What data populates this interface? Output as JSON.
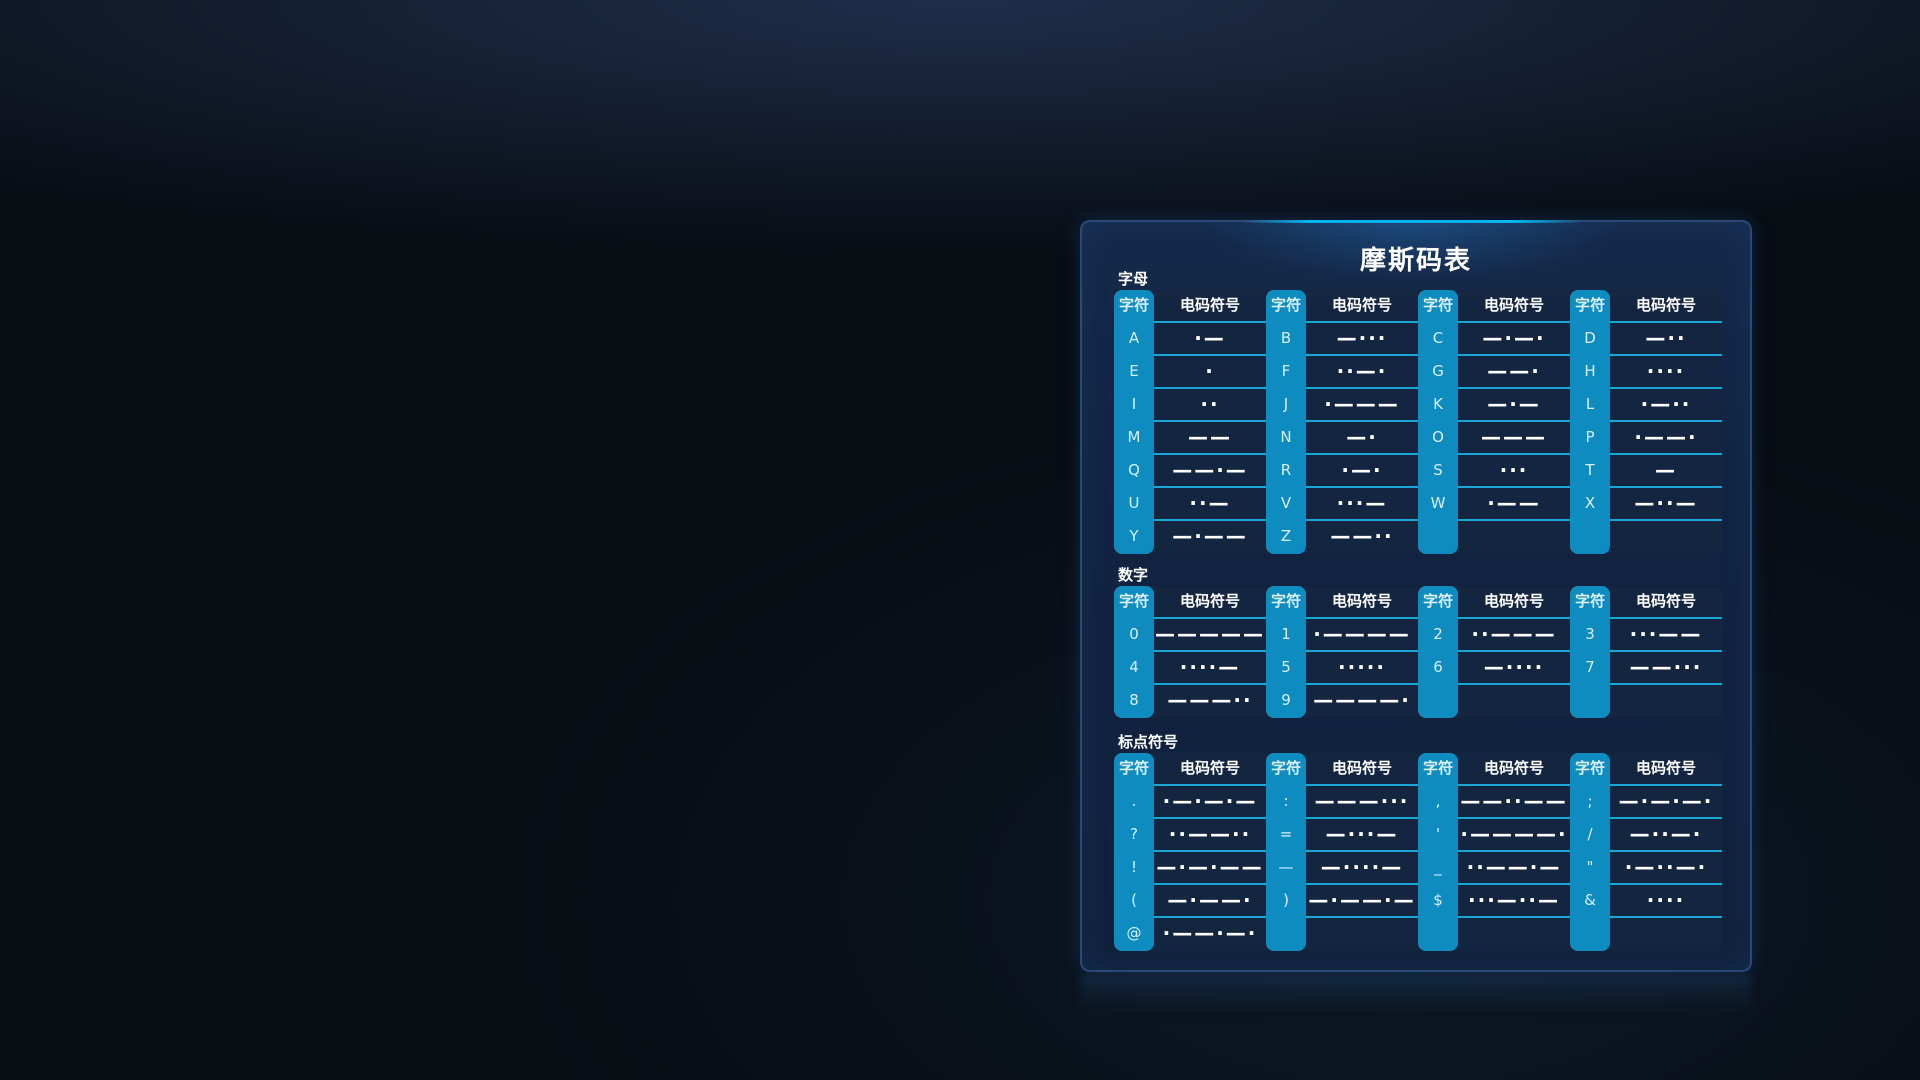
{
  "title": "摩斯码表",
  "headers": {
    "char": "字符",
    "code": "电码符号"
  },
  "sections": [
    {
      "label": "字母",
      "rows": [
        [
          [
            "A",
            "·—"
          ],
          [
            "B",
            "—···"
          ],
          [
            "C",
            "—·—·"
          ],
          [
            "D",
            "—··"
          ]
        ],
        [
          [
            "E",
            "·"
          ],
          [
            "F",
            "··—·"
          ],
          [
            "G",
            "——·"
          ],
          [
            "H",
            "····"
          ]
        ],
        [
          [
            "I",
            "··"
          ],
          [
            "J",
            "·———"
          ],
          [
            "K",
            "—·—"
          ],
          [
            "L",
            "·—··"
          ]
        ],
        [
          [
            "M",
            "——"
          ],
          [
            "N",
            "—·"
          ],
          [
            "O",
            "———"
          ],
          [
            "P",
            "·——·"
          ]
        ],
        [
          [
            "Q",
            "——·—"
          ],
          [
            "R",
            "·—·"
          ],
          [
            "S",
            "···"
          ],
          [
            "T",
            "—"
          ]
        ],
        [
          [
            "U",
            "··—"
          ],
          [
            "V",
            "···—"
          ],
          [
            "W",
            "·——"
          ],
          [
            "X",
            "—··—"
          ]
        ],
        [
          [
            "Y",
            "—·——"
          ],
          [
            "Z",
            "——··"
          ],
          [
            "",
            ""
          ],
          [
            "",
            ""
          ]
        ]
      ]
    },
    {
      "label": "数字",
      "rows": [
        [
          [
            "0",
            "—————"
          ],
          [
            "1",
            "·————"
          ],
          [
            "2",
            "··———"
          ],
          [
            "3",
            "···——"
          ]
        ],
        [
          [
            "4",
            "····—"
          ],
          [
            "5",
            "·····"
          ],
          [
            "6",
            "—····"
          ],
          [
            "7",
            "——···"
          ]
        ],
        [
          [
            "8",
            "———··"
          ],
          [
            "9",
            "————·"
          ],
          [
            "",
            ""
          ],
          [
            "",
            ""
          ]
        ]
      ]
    },
    {
      "label": "标点符号",
      "rows": [
        [
          [
            ".",
            "·—·—·—"
          ],
          [
            ":",
            "———···"
          ],
          [
            ",",
            "——··——"
          ],
          [
            ";",
            "—·—·—·"
          ]
        ],
        [
          [
            "?",
            "··——··"
          ],
          [
            "=",
            "—···—"
          ],
          [
            "'",
            "·————·"
          ],
          [
            "/",
            "—··—·"
          ]
        ],
        [
          [
            "!",
            "—·—·——"
          ],
          [
            "—",
            "—····—"
          ],
          [
            "_",
            "··——·—"
          ],
          [
            "\"",
            "·—··—·"
          ]
        ],
        [
          [
            "(",
            "—·——·"
          ],
          [
            ")",
            "—·——·—"
          ],
          [
            "$",
            "···—··—"
          ],
          [
            "&",
            "····"
          ]
        ],
        [
          [
            "@",
            "·——·—·"
          ],
          [
            "",
            ""
          ],
          [
            "",
            ""
          ],
          [
            "",
            ""
          ]
        ]
      ]
    }
  ]
}
